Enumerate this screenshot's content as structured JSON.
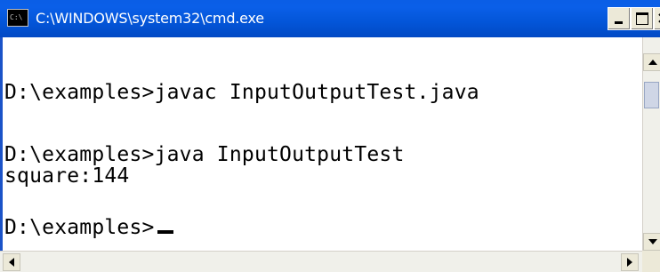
{
  "window": {
    "title": "C:\\WINDOWS\\system32\\cmd.exe",
    "icon": "console-icon",
    "icon_text": "C:\\"
  },
  "titlebar_buttons": {
    "minimize_icon": "minimize-icon",
    "maximize_icon": "maximize-icon",
    "close_icon": "close-icon",
    "close_glyph": "×"
  },
  "console": {
    "lines": [
      "D:\\examples>javac InputOutputTest.java",
      "",
      "D:\\examples>java InputOutputTest",
      "square:144",
      "",
      "D:\\examples>"
    ]
  },
  "colors": {
    "titlebar": "#0355d8",
    "console_bg": "#ffffff",
    "console_text": "#000000"
  }
}
